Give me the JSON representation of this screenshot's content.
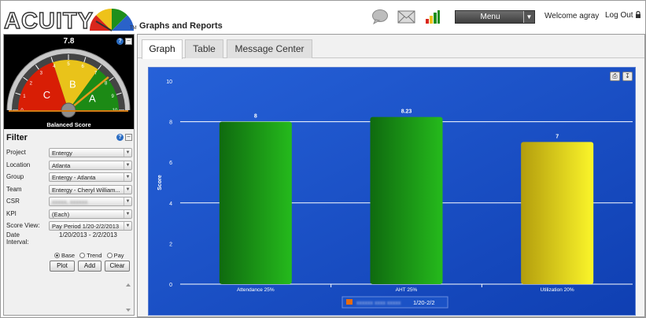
{
  "header": {
    "logo_text": "ACUITY",
    "logo_tm": "TM",
    "app_title": "Graphs and Reports",
    "menu_label": "Menu",
    "welcome": "Welcome agray",
    "logout": "Log Out",
    "icons": [
      "chat-bubble-icon",
      "envelope-icon",
      "bar-chart-icon",
      "lock-icon"
    ]
  },
  "gauge": {
    "value": "7.8",
    "label": "Balanced Score",
    "zones": [
      "C",
      "B",
      "A"
    ],
    "ticks": [
      "0",
      "1",
      "2",
      "3",
      "4",
      "5",
      "6",
      "7",
      "8",
      "9",
      "10"
    ],
    "needle_value": 7.8,
    "colors": {
      "c": "#d81e05",
      "b": "#e9c31a",
      "a": "#1c8a15"
    }
  },
  "filter": {
    "title": "Filter",
    "rows": [
      {
        "label": "Project",
        "value": "Entergy",
        "redacted": false
      },
      {
        "label": "Location",
        "value": "Atlanta",
        "redacted": false
      },
      {
        "label": "Group",
        "value": "Entergy - Atlanta",
        "redacted": false
      },
      {
        "label": "Team",
        "value": "Entergy - Cheryl William...",
        "redacted": false
      },
      {
        "label": "CSR",
        "value": "xxxxx, xxxxxx",
        "redacted": true
      },
      {
        "label": "KPI",
        "value": "(Each)",
        "redacted": false
      },
      {
        "label": "Score View:",
        "value": "Pay Period 1/20-2/2/2013",
        "redacted": false
      }
    ],
    "date_label": "Date Interval:",
    "date_value": "1/20/2013 - 2/2/2013",
    "radios": [
      {
        "label": "Base",
        "checked": true
      },
      {
        "label": "Trend",
        "checked": false
      },
      {
        "label": "Pay",
        "checked": false
      }
    ],
    "buttons": {
      "plot": "Plot",
      "add": "Add",
      "clear": "Clear"
    }
  },
  "tabs": [
    {
      "label": "Graph",
      "active": true
    },
    {
      "label": "Table",
      "active": false
    },
    {
      "label": "Message Center",
      "active": false
    }
  ],
  "chart_data": {
    "type": "bar",
    "categories": [
      "Attendance 25%",
      "AHT 25%",
      "Utilization 20%"
    ],
    "values": [
      8,
      8.23,
      7
    ],
    "data_labels": [
      "8",
      "8.23",
      "7"
    ],
    "bar_colors": [
      "#1b9a16",
      "#1b9a16",
      "#ecd21b"
    ],
    "ylabel": "Score",
    "ylim": [
      0,
      10
    ],
    "yticks": [
      "0",
      "2",
      "4",
      "6",
      "8",
      "10"
    ],
    "legend": {
      "swatch_color": "#e86b0d",
      "redacted_name": "xxxxxx xxxx xxxxx",
      "label": "1/20-2/2"
    },
    "grid": true
  }
}
